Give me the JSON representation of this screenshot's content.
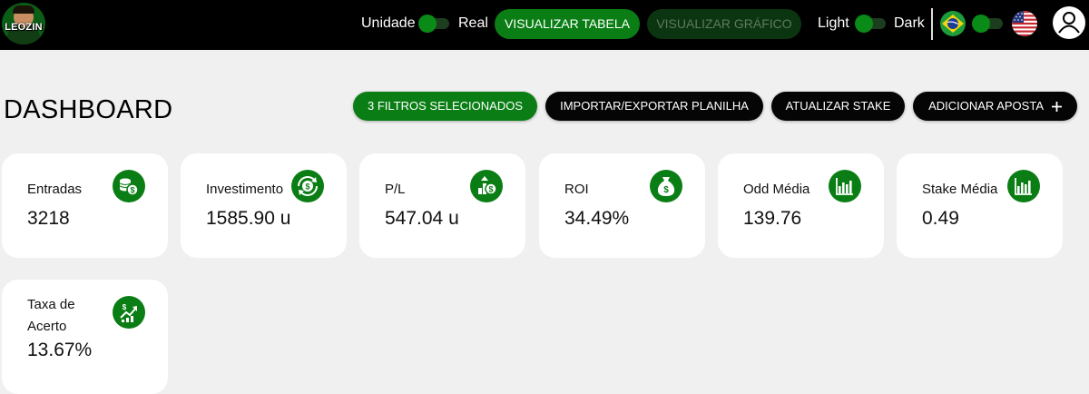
{
  "header": {
    "logo_text": "LEOZIN",
    "unit_toggle": {
      "left_label": "Unidade",
      "right_label": "Real"
    },
    "view_table_label": "VISUALIZAR TABELA",
    "view_chart_label": "VISUALIZAR GRÁFICO",
    "theme_toggle": {
      "left_label": "Light",
      "right_label": "Dark"
    },
    "languages": {
      "left": "brazil-flag-icon",
      "right": "usa-flag-icon"
    },
    "user_icon": "user-icon"
  },
  "page": {
    "title": "DASHBOARD",
    "actions": {
      "filters_label": "3 FILTROS SELECIONADOS",
      "import_export_label": "IMPORTAR/EXPORTAR PLANILHA",
      "update_stake_label": "ATUALIZAR STAKE",
      "add_bet_label": "ADICIONAR APOSTA",
      "add_bet_icon": "plus-icon"
    }
  },
  "cards": [
    {
      "label": "Entradas",
      "value": "3218",
      "icon": "coins-dollar-icon"
    },
    {
      "label": "Investimento",
      "value": "1585.90 u",
      "icon": "money-cycle-icon"
    },
    {
      "label": "P/L",
      "value": "547.04 u",
      "icon": "profit-chart-icon"
    },
    {
      "label": "ROI",
      "value": "34.49%",
      "icon": "money-bag-icon"
    },
    {
      "label": "Odd Média",
      "value": "139.76",
      "icon": "bar-chart-icon"
    },
    {
      "label": "Stake Média",
      "value": "0.49",
      "icon": "bar-chart-icon"
    },
    {
      "label": "Taxa de Acerto",
      "value": "13.67%",
      "icon": "trend-up-icon"
    }
  ],
  "colors": {
    "accent": "#0a7e15",
    "topbar": "#000000",
    "background": "#f0f0f0",
    "card": "#ffffff"
  }
}
